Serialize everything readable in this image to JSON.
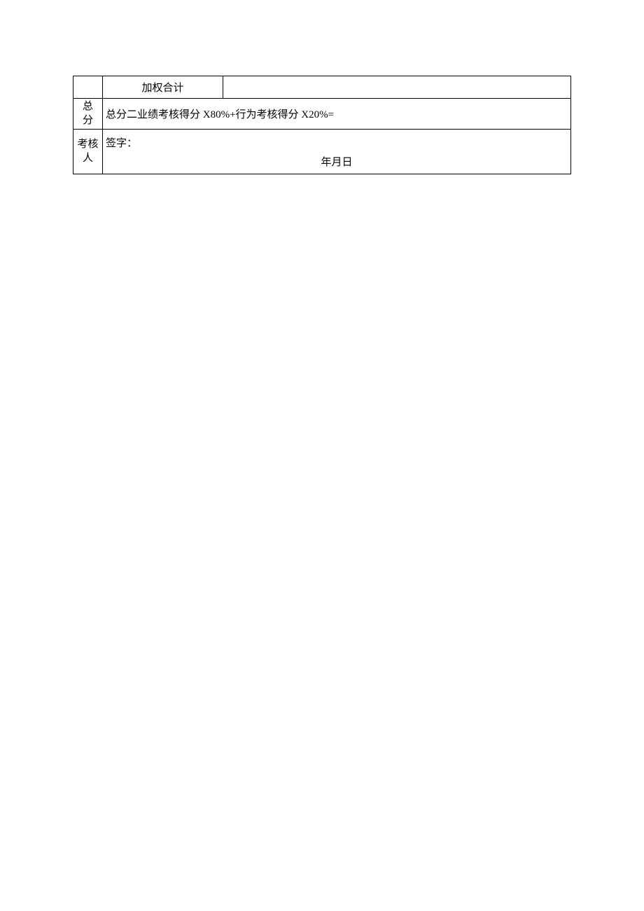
{
  "row1": {
    "weighted_total_label": "加权合计"
  },
  "row2": {
    "label_char1": "总",
    "label_char2": "分",
    "formula": "总分二业绩考核得分 X80%+行为考核得分 X20%="
  },
  "row3": {
    "label_char1": "考核",
    "label_char2": "人",
    "signature_label": "签字：",
    "date_label": "年月日"
  }
}
